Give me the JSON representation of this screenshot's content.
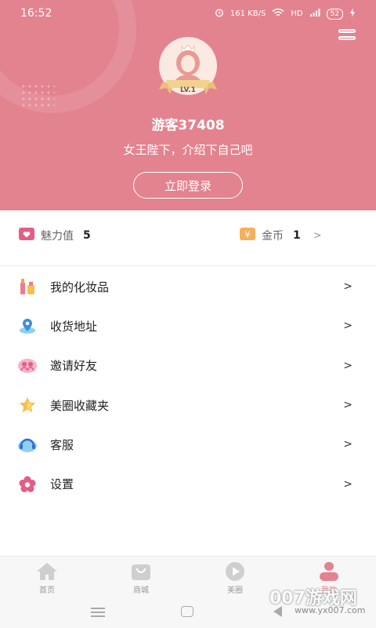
{
  "status_bar": {
    "time": "16:52",
    "network_speed": "161 KB/S",
    "network": "HD",
    "signal": "4G",
    "battery": "52"
  },
  "profile": {
    "level_badge": "LV.1",
    "username": "游客37408",
    "tagline": "女王陛下，介绍下自己吧",
    "login_button": "立即登录"
  },
  "stats": {
    "charm": {
      "label": "魅力值",
      "value": "5",
      "icon": "heart-icon",
      "color": "#e35d84"
    },
    "coins": {
      "label": "金币",
      "value": "1",
      "icon": "yen-icon",
      "color": "#f4b05a"
    }
  },
  "menu": [
    {
      "label": "我的化妆品",
      "icon": "cosmetics-icon"
    },
    {
      "label": "收货地址",
      "icon": "location-icon"
    },
    {
      "label": "邀请好友",
      "icon": "invite-icon"
    },
    {
      "label": "美圈收藏夹",
      "icon": "star-icon"
    },
    {
      "label": "客服",
      "icon": "headset-icon"
    },
    {
      "label": "设置",
      "icon": "settings-flower-icon"
    }
  ],
  "tabs": [
    {
      "label": "首页",
      "icon": "home-icon"
    },
    {
      "label": "商城",
      "icon": "shop-bag-icon"
    },
    {
      "label": "美圈",
      "icon": "play-icon"
    },
    {
      "label": "我的",
      "icon": "profile-icon",
      "active": true
    }
  ],
  "colors": {
    "header_bg": "#e3838f",
    "accent": "#e3838f"
  },
  "watermark": {
    "text": "007游戏网",
    "sub": "www.yx007.com"
  }
}
